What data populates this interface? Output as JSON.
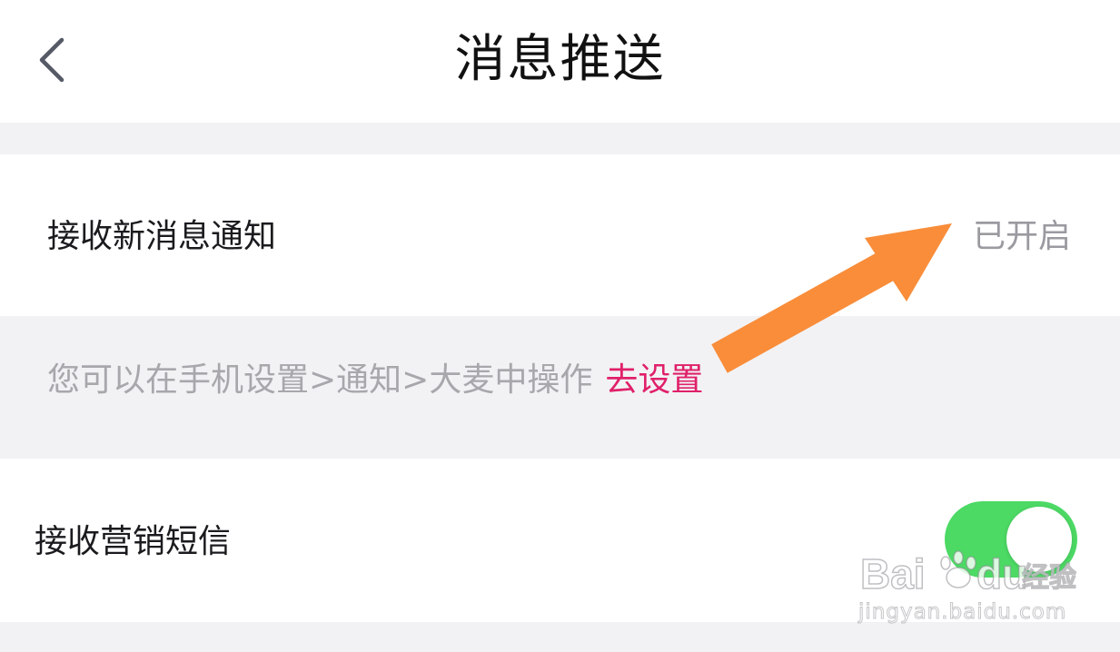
{
  "header": {
    "title": "消息推送",
    "back_icon": "chevron-left-icon"
  },
  "notify_row": {
    "label": "接收新消息通知",
    "status": "已开启"
  },
  "hint": {
    "text": "您可以在手机设置>通知>大麦中操作",
    "link": "去设置"
  },
  "sms_row": {
    "label": "接收营销短信",
    "toggle_on": true
  },
  "colors": {
    "accent_link": "#e0206a",
    "toggle_on": "#4cd964",
    "annotation_arrow": "#f98d3a",
    "background": "#f2f2f4"
  },
  "watermark": {
    "logo": "Baidu 经验",
    "url": "jingyan.baidu.com"
  }
}
